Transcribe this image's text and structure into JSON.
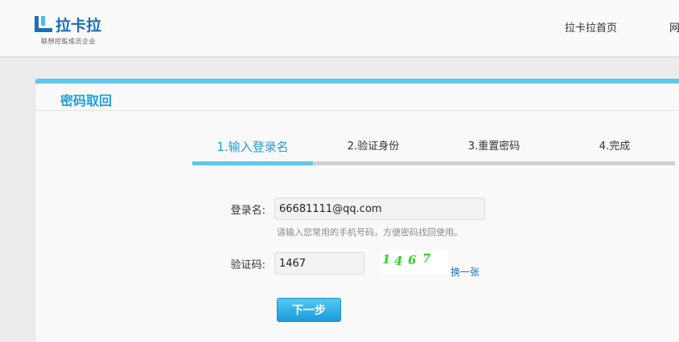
{
  "header": {
    "logo_name": "拉卡拉",
    "logo_tagline": "联想控股成员企业",
    "nav": [
      "拉卡拉首页",
      "网"
    ]
  },
  "panel": {
    "title": "密码取回"
  },
  "steps": [
    {
      "label": "1.输入登录名",
      "active": true
    },
    {
      "label": "2.验证身份",
      "active": false
    },
    {
      "label": "3.重置密码",
      "active": false
    },
    {
      "label": "4.完成",
      "active": false
    }
  ],
  "form": {
    "login_label": "登录名:",
    "login_value": "66681111@qq.com",
    "login_hint": "请输入您常用的手机号码，方便密码找回使用。",
    "captcha_label": "验证码:",
    "captcha_value": "1467",
    "captcha_chars": [
      "1",
      "4",
      "6",
      "7"
    ],
    "refresh_label": "换一张",
    "next_label": "下一步"
  },
  "colors": {
    "accent": "#1ea0db",
    "bar_active": "#5ec7ee",
    "bar_inactive": "#d0d0d0",
    "captcha_text": "#2ed12a",
    "logo": "#1b6fb5"
  }
}
